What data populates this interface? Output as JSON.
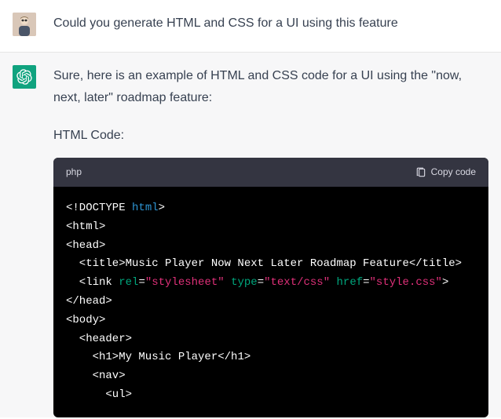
{
  "user": {
    "text": "Could you generate HTML and CSS for a UI using this feature"
  },
  "assistant": {
    "intro": "Sure, here is an example of HTML and CSS code for a UI using the \"now, next, later\" roadmap feature:",
    "label": "HTML Code:"
  },
  "code": {
    "lang": "php",
    "copy": "Copy code",
    "lines": {
      "l1_a": "<!DOCTYPE ",
      "l1_b": "html",
      "l1_c": ">",
      "l2": "<html>",
      "l3": "<head>",
      "l4_a": "<title>",
      "l4_b": "Music Player Now Next Later Roadmap Feature",
      "l4_c": "</title>",
      "l5_a": "<link ",
      "l5_b": "rel",
      "l5_c": "=",
      "l5_d": "\"stylesheet\"",
      "l5_e": "type",
      "l5_f": "=",
      "l5_g": "\"text/css\"",
      "l5_h": "href",
      "l5_i": "=",
      "l5_j": "\"style.css\"",
      "l5_k": ">",
      "l6": "</head>",
      "l7": "<body>",
      "l8": "<header>",
      "l9_a": "<h1>",
      "l9_b": "My Music Player",
      "l9_c": "</h1>",
      "l10": "<nav>",
      "l11": "<ul>"
    }
  }
}
